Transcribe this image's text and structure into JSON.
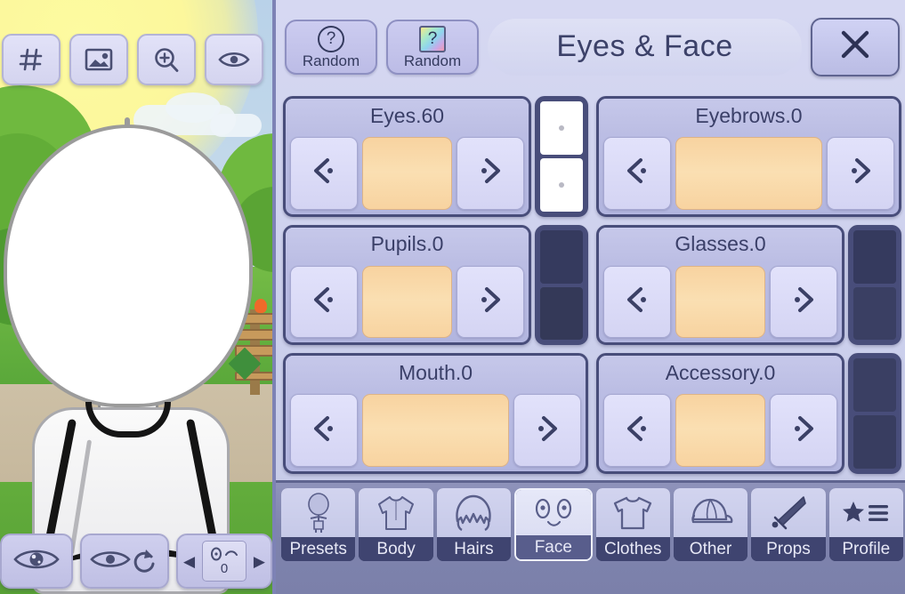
{
  "scene": {
    "toolbar": [
      {
        "name": "hash-icon",
        "label": "#"
      },
      {
        "name": "image-icon",
        "label": "image"
      },
      {
        "name": "zoom-in-icon",
        "label": "zoom in"
      },
      {
        "name": "eye-icon",
        "label": "eye"
      }
    ],
    "face_controls": {
      "eye_toggle_icon": "eye-pupil-icon",
      "eye_reset_icon": "eye-refresh-icon",
      "prev_label": "◀",
      "next_label": "▶",
      "expression_value": "0",
      "expression_icon": "wink-face-icon"
    }
  },
  "panel": {
    "random_plain": {
      "label": "Random",
      "icon": "question-circle-icon",
      "glyph": "?"
    },
    "random_color": {
      "label": "Random",
      "icon": "rainbow-question-icon",
      "glyph": "?"
    },
    "title": "Eyes & Face",
    "close_label": "✕",
    "arrow_prev_icon": "chevron-left-dot-icon",
    "arrow_next_icon": "chevron-right-dot-icon",
    "options": [
      {
        "name": "eyes",
        "title": "Eyes.60",
        "swatch_color": "#f8d3a0",
        "colors": [
          "#ffffff",
          "#ffffff"
        ],
        "has_colors": true
      },
      {
        "name": "eyebrows",
        "title": "Eyebrows.0",
        "swatch_color": "#f8d3a0",
        "colors": [],
        "has_colors": false
      },
      {
        "name": "pupils",
        "title": "Pupils.0",
        "swatch_color": "#f8d3a0",
        "colors": [
          "#353a5e",
          "#343958"
        ],
        "has_colors": true
      },
      {
        "name": "glasses",
        "title": "Glasses.0",
        "swatch_color": "#f8d3a0",
        "colors": [
          "#353a5e",
          "#3a3f63"
        ],
        "has_colors": true
      },
      {
        "name": "mouth",
        "title": "Mouth.0",
        "swatch_color": "#f8d3a0",
        "colors": [],
        "has_colors": false
      },
      {
        "name": "accessory",
        "title": "Accessory.0",
        "swatch_color": "#f8d3a0",
        "colors": [
          "#3a3f63",
          "#383d60"
        ],
        "has_colors": true
      }
    ],
    "tabs": [
      {
        "name": "presets",
        "label": "Presets",
        "icon": "character-body-icon",
        "active": false
      },
      {
        "name": "body",
        "label": "Body",
        "icon": "shirt-sleeves-icon",
        "active": false
      },
      {
        "name": "hairs",
        "label": "Hairs",
        "icon": "hair-icon",
        "active": false
      },
      {
        "name": "face",
        "label": "Face",
        "icon": "face-eyes-icon",
        "active": true
      },
      {
        "name": "clothes",
        "label": "Clothes",
        "icon": "tshirt-icon",
        "active": false
      },
      {
        "name": "other",
        "label": "Other",
        "icon": "cap-icon",
        "active": false
      },
      {
        "name": "props",
        "label": "Props",
        "icon": "sword-icon",
        "active": false
      },
      {
        "name": "profile",
        "label": "Profile",
        "icon": "star-list-icon",
        "active": false
      }
    ]
  },
  "colors": {
    "panel_bg": "#ccd0ec",
    "card_border": "#484d7a",
    "accent_text": "#3a3f68",
    "tabbar_bg": "#7f84ae",
    "swatch": "#f8d3a0"
  }
}
